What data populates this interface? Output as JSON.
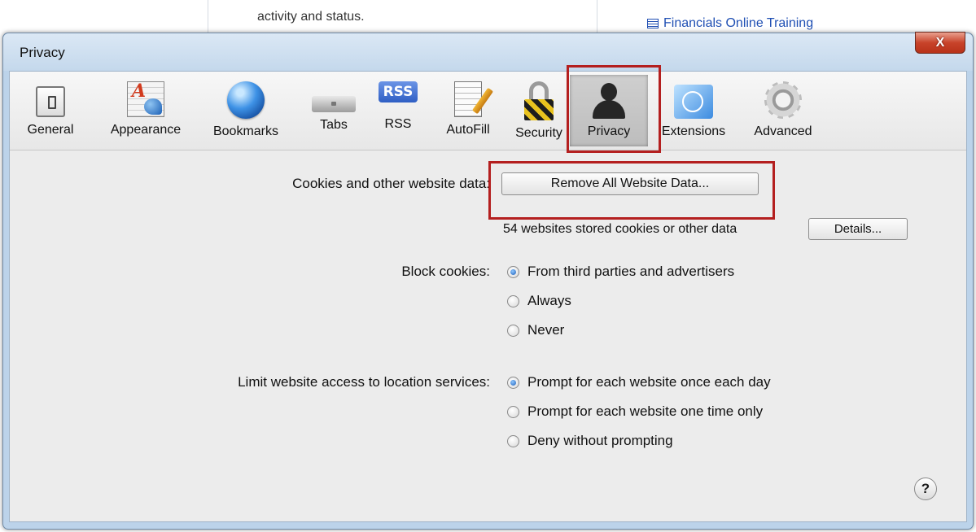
{
  "background": {
    "text": "activity and status.",
    "link": "Financials Online Training"
  },
  "window": {
    "title": "Privacy",
    "close_label": "X"
  },
  "toolbar": {
    "items": [
      {
        "label": "General",
        "icon": "switch-icon"
      },
      {
        "label": "Appearance",
        "icon": "appearance-icon"
      },
      {
        "label": "Bookmarks",
        "icon": "globe-icon"
      },
      {
        "label": "Tabs",
        "icon": "tabs-icon"
      },
      {
        "label": "RSS",
        "icon": "rss-icon",
        "badge": "RSS"
      },
      {
        "label": "AutoFill",
        "icon": "pencil-form-icon"
      },
      {
        "label": "Security",
        "icon": "padlock-icon"
      },
      {
        "label": "Privacy",
        "icon": "silhouette-icon",
        "selected": true
      },
      {
        "label": "Extensions",
        "icon": "puzzle-icon"
      },
      {
        "label": "Advanced",
        "icon": "gear-icon"
      }
    ]
  },
  "cookies": {
    "label": "Cookies and other website data:",
    "remove_button": "Remove All Website Data...",
    "note": "54 websites stored cookies or other data",
    "details_button": "Details..."
  },
  "block_cookies": {
    "label": "Block cookies:",
    "options": [
      "From third parties and advertisers",
      "Always",
      "Never"
    ],
    "selected": "From third parties and advertisers"
  },
  "location": {
    "label": "Limit website access to location services:",
    "options": [
      "Prompt for each website once each day",
      "Prompt for each website one time only",
      "Deny without prompting"
    ],
    "selected": "Prompt for each website once each day"
  },
  "help_label": "?",
  "colors": {
    "highlight": "#b41f1f",
    "radio_selected": "#1e5fb8",
    "window_frame": "#bcd3ea"
  }
}
